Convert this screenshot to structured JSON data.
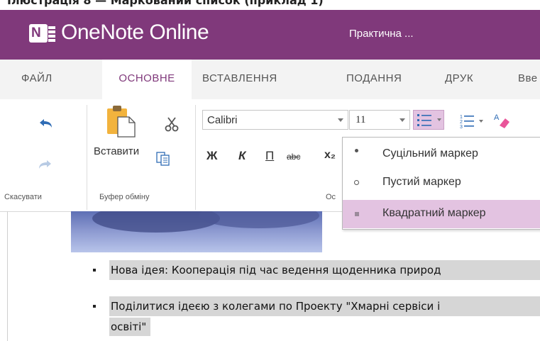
{
  "app": {
    "top_caption": "Ілюстрація 8 — Маркований список (приклад 1)",
    "name": "OneNote Online",
    "document_title": "Практична ..."
  },
  "tabs": [
    {
      "label": "ФАЙЛ",
      "active": false
    },
    {
      "label": "ОСНОВНЕ",
      "active": true
    },
    {
      "label": "ВСТАВЛЕННЯ",
      "active": false
    },
    {
      "label": "ПОДАННЯ",
      "active": false
    },
    {
      "label": "ДРУК",
      "active": false
    },
    {
      "label": "Вве",
      "active": false
    }
  ],
  "ribbon": {
    "undo_group_label": "Скасувати",
    "clipboard_group_label": "Буфер обміну",
    "paste_label": "Вставити",
    "font_group_label_partial": "Ос",
    "font_name": "Calibri",
    "font_size": "11",
    "format_buttons": {
      "bold": "Ж",
      "italic": "К",
      "underline": "П",
      "strikethrough": "abc",
      "subscript": "x₂"
    }
  },
  "bullet_menu": {
    "items": [
      {
        "label": "Суцільний маркер",
        "marker": "•",
        "selected": false
      },
      {
        "label": "Пустий маркер",
        "marker": "○",
        "selected": false
      },
      {
        "label": "Квадратний маркер",
        "marker": "■",
        "selected": true
      }
    ]
  },
  "page": {
    "items": [
      {
        "text": "Нова ідея: Кооперація під час ведення щоденника природ"
      },
      {
        "text": "Поділитися ідеєю з колегами по Проекту \"Хмарні сервіси і",
        "continuation": "освіті\""
      }
    ]
  },
  "colors": {
    "brand": "#80397b",
    "tab_bar": "#f3f3f3",
    "menu_selected": "#e3c3e1",
    "selection_highlight": "#d6d6d6",
    "icon_blue": "#2f6cb5"
  }
}
